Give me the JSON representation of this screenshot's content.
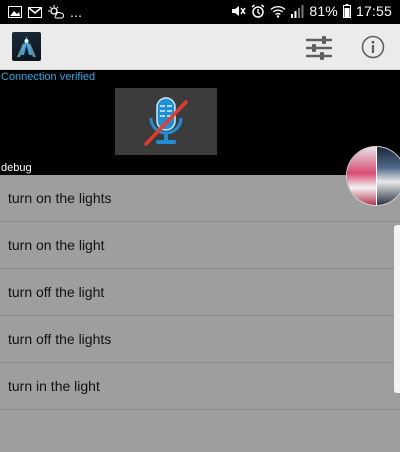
{
  "status_bar": {
    "left_overflow": "...",
    "battery": "81%",
    "time": "17:55"
  },
  "app_bar": {
    "settings_icon": "sliders-icon",
    "info_icon": "info-icon"
  },
  "top": {
    "connection_status": "Connection verified",
    "mic_state": "muted",
    "debug_label": "debug"
  },
  "commands": [
    "turn on the lights",
    "turn on the light",
    "turn off the light",
    "turn off the lights",
    "turn in the light"
  ],
  "colors": {
    "accent": "#2ea8e0",
    "mic_blue": "#1f8fd6",
    "mute_slash": "#e43b2c",
    "list_bg": "#9e9e9e"
  }
}
